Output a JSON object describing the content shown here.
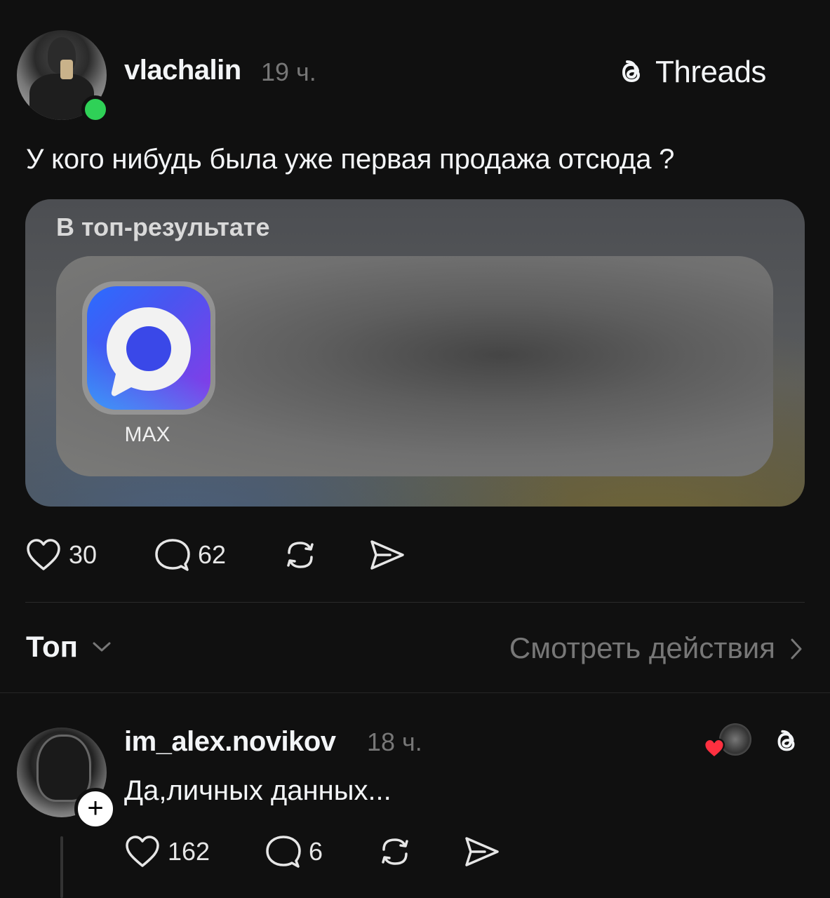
{
  "post": {
    "author": "vlachalin",
    "time": "19 ч.",
    "brand_label": "Threads",
    "text": "У кого нибудь была уже первая продажа отсюда ?",
    "media": {
      "title": "В топ-результате",
      "app_name": "MAX"
    },
    "actions": {
      "likes": "30",
      "comments": "62"
    }
  },
  "replies_header": {
    "sort_label": "Топ",
    "view_activity": "Смотреть действия"
  },
  "reply": {
    "author": "im_alex.novikov",
    "time": "18 ч.",
    "text": "Да,личных данных...",
    "follow_symbol": "+",
    "actions": {
      "likes": "162",
      "comments": "6"
    }
  },
  "colors": {
    "background": "#101010",
    "online": "#2fd157",
    "like_heart": "#ff3040",
    "secondary_text": "#777777"
  },
  "icons": [
    "threads-logo",
    "heart-icon",
    "comment-icon",
    "repost-icon",
    "share-icon",
    "chevron-down-icon",
    "chevron-right-icon"
  ]
}
